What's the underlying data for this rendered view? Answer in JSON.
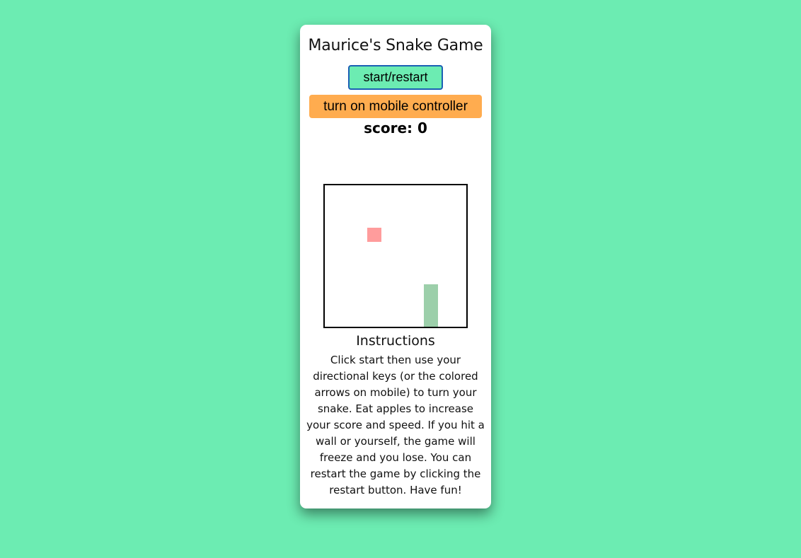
{
  "page": {
    "background_color": "#6cecb2"
  },
  "game": {
    "title": "Maurice's Snake Game",
    "start_button_label": "start/restart",
    "mobile_button_label": "turn on mobile controller",
    "score_label": "score: 0",
    "score": 0
  },
  "board": {
    "grid_size": 10,
    "apple": {
      "col": 3,
      "row": 3,
      "color": "#ff9c9c"
    },
    "snake": {
      "color": "#9ccfaa",
      "segments": [
        {
          "col": 7,
          "row": 7
        },
        {
          "col": 7,
          "row": 8
        },
        {
          "col": 7,
          "row": 9
        }
      ]
    }
  },
  "instructions": {
    "title": "Instructions",
    "text": "Click start then use your directional keys (or the colored arrows on mobile) to turn your snake. Eat apples to increase your score and speed. If you hit a wall or yourself, the game will freeze and you lose. You can restart the game by clicking the restart button. Have fun!"
  },
  "colors": {
    "start_button": "#6cecb2",
    "start_button_border": "#1a5fb4",
    "mobile_button": "#ffac4f"
  }
}
